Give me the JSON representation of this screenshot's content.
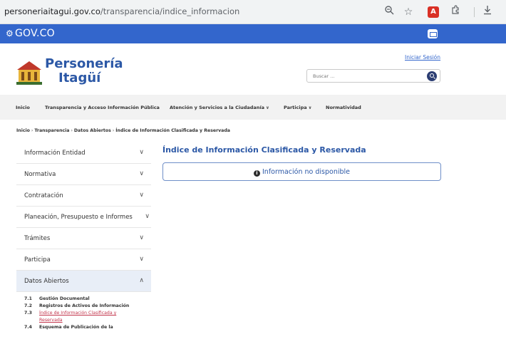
{
  "browser": {
    "url_host": "personeriaitagui.gov.co",
    "url_path": "/transparencia/indice_informacion",
    "icons": [
      "zoom-icon",
      "star-icon",
      "pdf-extension-icon",
      "extensions-icon",
      "download-icon"
    ]
  },
  "gov_bar": {
    "logo": "GOV.CO",
    "color": "#3366cc"
  },
  "header": {
    "logo_line1": "Personería",
    "logo_line2": "Itagüí",
    "login_link": "Iniciar Sesión",
    "search_placeholder": "Buscar ..."
  },
  "nav": {
    "items": [
      {
        "label": "Inicio"
      },
      {
        "label": "Transparencia y Acceso Información Pública"
      },
      {
        "label": "Atención y Servicios a la Ciudadanía",
        "dropdown": true
      },
      {
        "label": "Participa",
        "dropdown": true
      },
      {
        "label": "Normatividad"
      }
    ]
  },
  "breadcrumb": [
    "Inicio",
    "Transparencia",
    "Datos Abiertos",
    "Índice de Información Clasificada y Reservada"
  ],
  "sidebar": {
    "items": [
      {
        "label": "Información Entidad",
        "expanded": false
      },
      {
        "label": "Normativa",
        "expanded": false
      },
      {
        "label": "Contratación",
        "expanded": false
      },
      {
        "label": "Planeación, Presupuesto e Informes",
        "expanded": false
      },
      {
        "label": "Trámites",
        "expanded": false
      },
      {
        "label": "Participa",
        "expanded": false
      },
      {
        "label": "Datos Abiertos",
        "expanded": true
      }
    ],
    "sub_items": [
      {
        "num": "7.1",
        "label": "Gestión Documental"
      },
      {
        "num": "7.2",
        "label": "Registros de Activos de Información"
      },
      {
        "num": "7.3",
        "label": "Índice de Información Clasificada y",
        "current": true
      },
      {
        "num": "",
        "label": "Reservada",
        "current": true
      },
      {
        "num": "7.4",
        "label": "Esquema de Publicación de la"
      }
    ]
  },
  "main": {
    "title": "Índice de Información Clasificada y Reservada",
    "notice": "Información no disponible"
  }
}
